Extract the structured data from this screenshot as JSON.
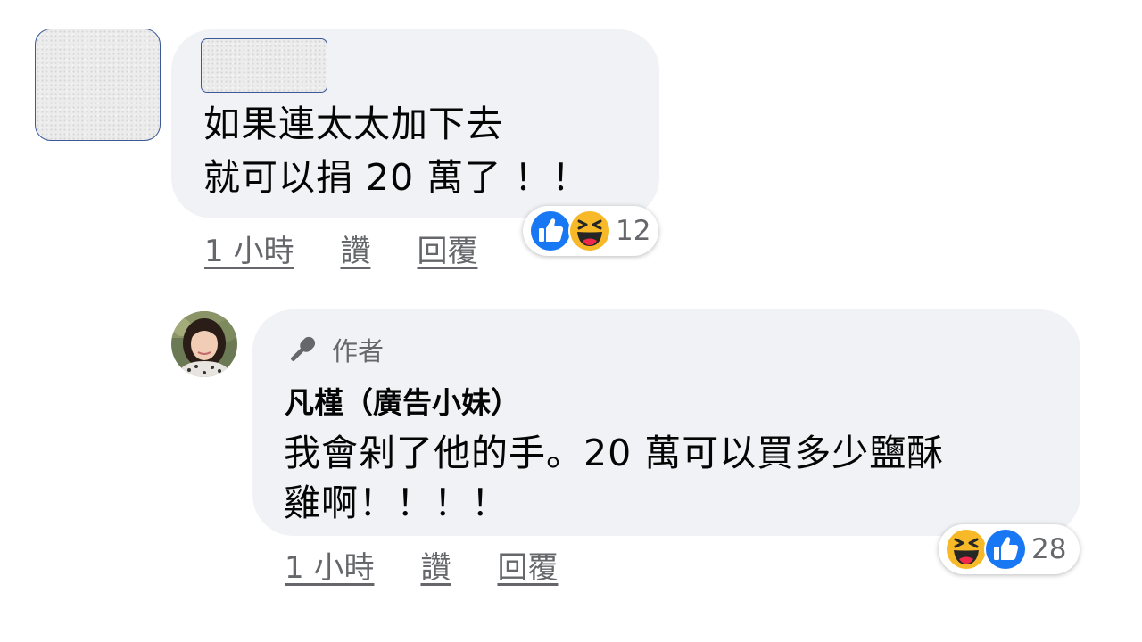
{
  "comment1": {
    "lines": [
      "如果連太太加下去",
      "就可以捐 20 萬了 ！！"
    ],
    "actions": {
      "time": "1 小時",
      "like": "讚",
      "reply": "回覆"
    },
    "reaction_count": "12",
    "reactions": [
      "like-icon",
      "haha-icon"
    ]
  },
  "comment2": {
    "badge_label": "作者",
    "author_name": "凡槿（廣告小妹）",
    "lines": [
      "我會剁了他的手。20 萬可以買多少鹽酥",
      "雞啊！！！！"
    ],
    "actions": {
      "time": "1 小時",
      "like": "讚",
      "reply": "回覆"
    },
    "reaction_count": "28",
    "reactions": [
      "haha-icon",
      "like-icon"
    ]
  },
  "colors": {
    "bubble": "#f0f2f5",
    "text": "#050505",
    "secondary": "#65676b",
    "like_blue": "#1877f2",
    "haha_yellow": "#f7b928"
  }
}
